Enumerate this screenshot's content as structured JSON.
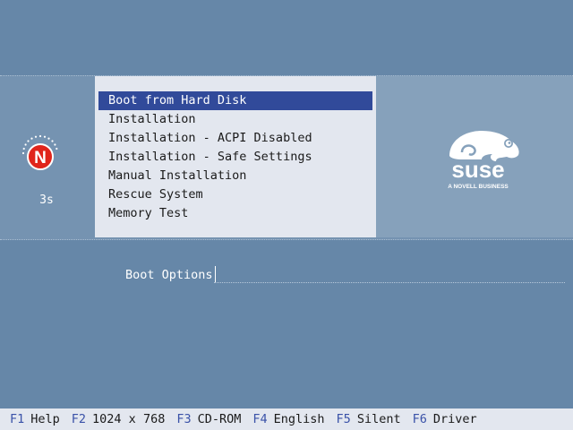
{
  "countdown": "3s",
  "menu": {
    "items": [
      {
        "label": "Boot from Hard Disk",
        "selected": true
      },
      {
        "label": "Installation"
      },
      {
        "label": "Installation - ACPI Disabled"
      },
      {
        "label": "Installation - Safe Settings"
      },
      {
        "label": "Manual Installation"
      },
      {
        "label": "Rescue System"
      },
      {
        "label": "Memory Test"
      }
    ]
  },
  "boot_options": {
    "label": "Boot Options",
    "value": ""
  },
  "brand": {
    "name": "suse",
    "tagline": "A NOVELL BUSINESS",
    "novell_letter": "N"
  },
  "function_keys": [
    {
      "key": "F1",
      "label": "Help"
    },
    {
      "key": "F2",
      "label": "1024 x 768"
    },
    {
      "key": "F3",
      "label": "CD-ROM"
    },
    {
      "key": "F4",
      "label": "English"
    },
    {
      "key": "F5",
      "label": "Silent"
    },
    {
      "key": "F6",
      "label": "Driver"
    }
  ],
  "colors": {
    "background": "#6687a8",
    "selection": "#314a9a",
    "novell_red": "#e0241b",
    "key_blue": "#3a52a8"
  }
}
